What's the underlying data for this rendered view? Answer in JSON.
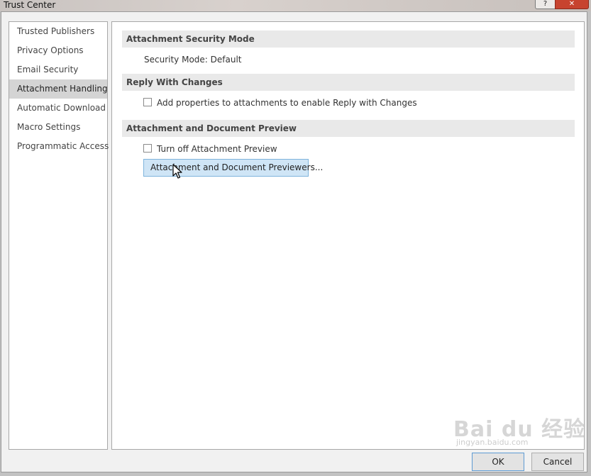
{
  "window": {
    "title": "Trust Center",
    "help_glyph": "?",
    "close_glyph": "✕"
  },
  "nav": {
    "items": [
      {
        "label": "Trusted Publishers"
      },
      {
        "label": "Privacy Options"
      },
      {
        "label": "Email Security"
      },
      {
        "label": "Attachment Handling",
        "selected": true
      },
      {
        "label": "Automatic Download"
      },
      {
        "label": "Macro Settings"
      },
      {
        "label": "Programmatic Access"
      }
    ]
  },
  "content": {
    "attachment_security_mode": {
      "header": "Attachment Security Mode",
      "mode_text": "Security Mode: Default"
    },
    "reply_with_changes": {
      "header": "Reply With Changes",
      "checkbox_label": "Add properties to attachments to enable Reply with Changes",
      "checked": false
    },
    "preview": {
      "header": "Attachment and Document Preview",
      "checkbox_label": "Turn off Attachment Preview",
      "checked": false,
      "previewers_button": "Attachment and Document Previewers..."
    }
  },
  "footer": {
    "ok_label": "OK",
    "cancel_label": "Cancel"
  },
  "watermark": {
    "logo": "Bai du 经验",
    "url": "jingyan.baidu.com"
  },
  "colors": {
    "selected_nav_bg": "#d4d4d4",
    "section_header_bg": "#e9e9e9",
    "button_hover_bg": "#cfe5f6",
    "close_button": "#c7432f"
  }
}
